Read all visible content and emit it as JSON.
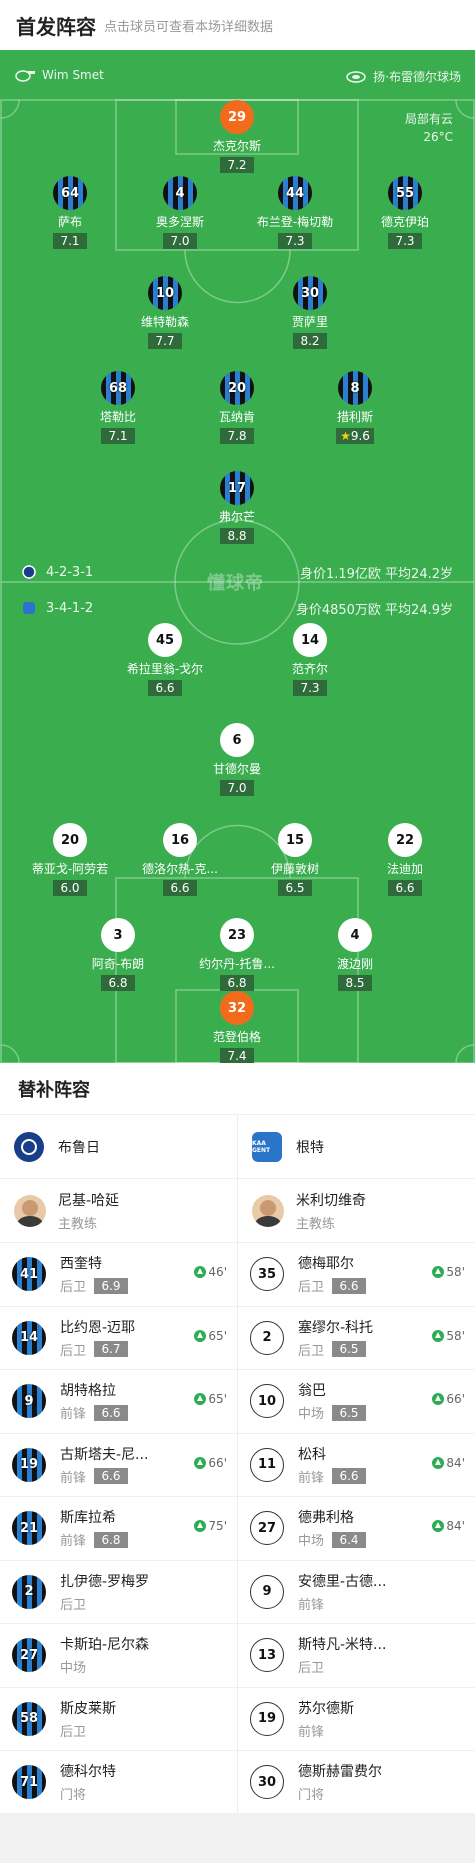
{
  "header": {
    "title": "首发阵容",
    "subtitle": "点击球员可查看本场详细数据"
  },
  "pitch": {
    "referee": "Wim Smet",
    "venue": "扬·布雷德尔球场",
    "weather_desc": "局部有云",
    "temperature": "26°C",
    "watermark": "懂球帝",
    "home_formation": {
      "formation": "4-2-3-1",
      "stats": "身价1.19亿欧  平均24.2岁"
    },
    "away_formation": {
      "formation": "3-4-1-2",
      "stats": "身价4850万欧  平均24.9岁"
    }
  },
  "home_players": [
    {
      "num": "29",
      "name": "杰克尔斯",
      "rating": "7.2",
      "kit": "gk"
    },
    {
      "num": "64",
      "name": "萨布",
      "rating": "7.1",
      "kit": "home",
      "sub_min": "46'"
    },
    {
      "num": "4",
      "name": "奥多涅斯",
      "rating": "7.0",
      "kit": "home"
    },
    {
      "num": "44",
      "name": "布兰登-梅切勒",
      "rating": "7.3",
      "kit": "home"
    },
    {
      "num": "55",
      "name": "德克伊珀",
      "rating": "7.3",
      "kit": "home",
      "sub_min": "66'"
    },
    {
      "num": "10",
      "name": "维特勒森",
      "rating": "7.7",
      "kit": "home"
    },
    {
      "num": "30",
      "name": "贾萨里",
      "rating": "8.2",
      "kit": "home"
    },
    {
      "num": "68",
      "name": "塔勒比",
      "rating": "7.1",
      "kit": "home",
      "sub_min": "75'"
    },
    {
      "num": "20",
      "name": "瓦纳肯",
      "rating": "7.8",
      "kit": "home",
      "sub_min": "65'",
      "captain": "C"
    },
    {
      "num": "8",
      "name": "措利斯",
      "rating": "9.6",
      "kit": "home",
      "star": true
    },
    {
      "num": "17",
      "name": "弗尔芒",
      "rating": "8.8",
      "kit": "home",
      "sub_min": "65'"
    }
  ],
  "away_players": [
    {
      "num": "45",
      "name": "希拉里翁-戈尔",
      "rating": "6.6",
      "kit": "away",
      "sub_min": "66'"
    },
    {
      "num": "14",
      "name": "范齐尔",
      "rating": "7.3",
      "kit": "away"
    },
    {
      "num": "6",
      "name": "甘德尔曼",
      "rating": "7.0",
      "kit": "away"
    },
    {
      "num": "20",
      "name": "蒂亚戈-阿劳若",
      "rating": "6.0",
      "kit": "away",
      "sub_min": "84'"
    },
    {
      "num": "16",
      "name": "德洛尔热-克...",
      "rating": "6.6",
      "kit": "away",
      "sub_min": "84'"
    },
    {
      "num": "15",
      "name": "伊藤敦树",
      "rating": "6.5",
      "kit": "away"
    },
    {
      "num": "22",
      "name": "法迪加",
      "rating": "6.6",
      "kit": "away",
      "sub_min": "58'"
    },
    {
      "num": "3",
      "name": "阿奇-布朗",
      "rating": "6.8",
      "kit": "away"
    },
    {
      "num": "23",
      "name": "约尔丹-托鲁...",
      "rating": "6.8",
      "kit": "away",
      "sub_min": "58'",
      "yellow": true
    },
    {
      "num": "4",
      "name": "渡边刚",
      "rating": "8.5",
      "kit": "away",
      "captain": "C"
    },
    {
      "num": "32",
      "name": "范登伯格",
      "rating": "7.4",
      "kit": "gk"
    }
  ],
  "subs_section": {
    "title": "替补阵容",
    "home": {
      "team": "布鲁日",
      "coach_name": "尼基-哈延",
      "coach_role": "主教练",
      "players": [
        {
          "num": "41",
          "name": "西奎特",
          "pos": "后卫",
          "rating": "6.9",
          "min": "46'"
        },
        {
          "num": "14",
          "name": "比约恩-迈耶",
          "pos": "后卫",
          "rating": "6.7",
          "min": "65'"
        },
        {
          "num": "9",
          "name": "胡特格拉",
          "pos": "前锋",
          "rating": "6.6",
          "min": "65'"
        },
        {
          "num": "19",
          "name": "古斯塔夫-尼...",
          "pos": "前锋",
          "rating": "6.6",
          "min": "66'"
        },
        {
          "num": "21",
          "name": "斯库拉希",
          "pos": "前锋",
          "rating": "6.8",
          "min": "75'"
        },
        {
          "num": "2",
          "name": "扎伊德-罗梅罗",
          "pos": "后卫"
        },
        {
          "num": "27",
          "name": "卡斯珀-尼尔森",
          "pos": "中场"
        },
        {
          "num": "58",
          "name": "斯皮莱斯",
          "pos": "后卫"
        },
        {
          "num": "71",
          "name": "德科尔特",
          "pos": "门将"
        }
      ]
    },
    "away": {
      "team": "根特",
      "team_logo_text": "KAA GENT",
      "coach_name": "米利切维奇",
      "coach_role": "主教练",
      "players": [
        {
          "num": "35",
          "name": "德梅耶尔",
          "pos": "后卫",
          "rating": "6.6",
          "min": "58'"
        },
        {
          "num": "2",
          "name": "塞缪尔-科托",
          "pos": "后卫",
          "rating": "6.5",
          "min": "58'"
        },
        {
          "num": "10",
          "name": "翁巴",
          "pos": "中场",
          "rating": "6.5",
          "min": "66'"
        },
        {
          "num": "11",
          "name": "松科",
          "pos": "前锋",
          "rating": "6.6",
          "min": "84'"
        },
        {
          "num": "27",
          "name": "德弗利格",
          "pos": "中场",
          "rating": "6.4",
          "min": "84'"
        },
        {
          "num": "9",
          "name": "安德里-古德...",
          "pos": "前锋"
        },
        {
          "num": "13",
          "name": "斯特凡-米特...",
          "pos": "后卫"
        },
        {
          "num": "19",
          "name": "苏尔德斯",
          "pos": "前锋"
        },
        {
          "num": "30",
          "name": "德斯赫雷费尔",
          "pos": "门将"
        }
      ]
    }
  }
}
